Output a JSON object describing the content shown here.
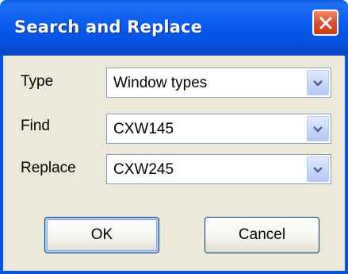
{
  "window": {
    "title": "Search and Replace"
  },
  "icons": {
    "close": "close-icon",
    "dropdown": "chevron-down-icon"
  },
  "form": {
    "type": {
      "label": "Type",
      "value": "Window types"
    },
    "find": {
      "label": "Find",
      "value": "CXW145"
    },
    "replace": {
      "label": "Replace",
      "value": "CXW245"
    }
  },
  "buttons": {
    "ok": "OK",
    "cancel": "Cancel"
  },
  "colors": {
    "titlebar": "#0553e2",
    "close": "#e1532f",
    "dialog_background": "#ece9d8"
  }
}
